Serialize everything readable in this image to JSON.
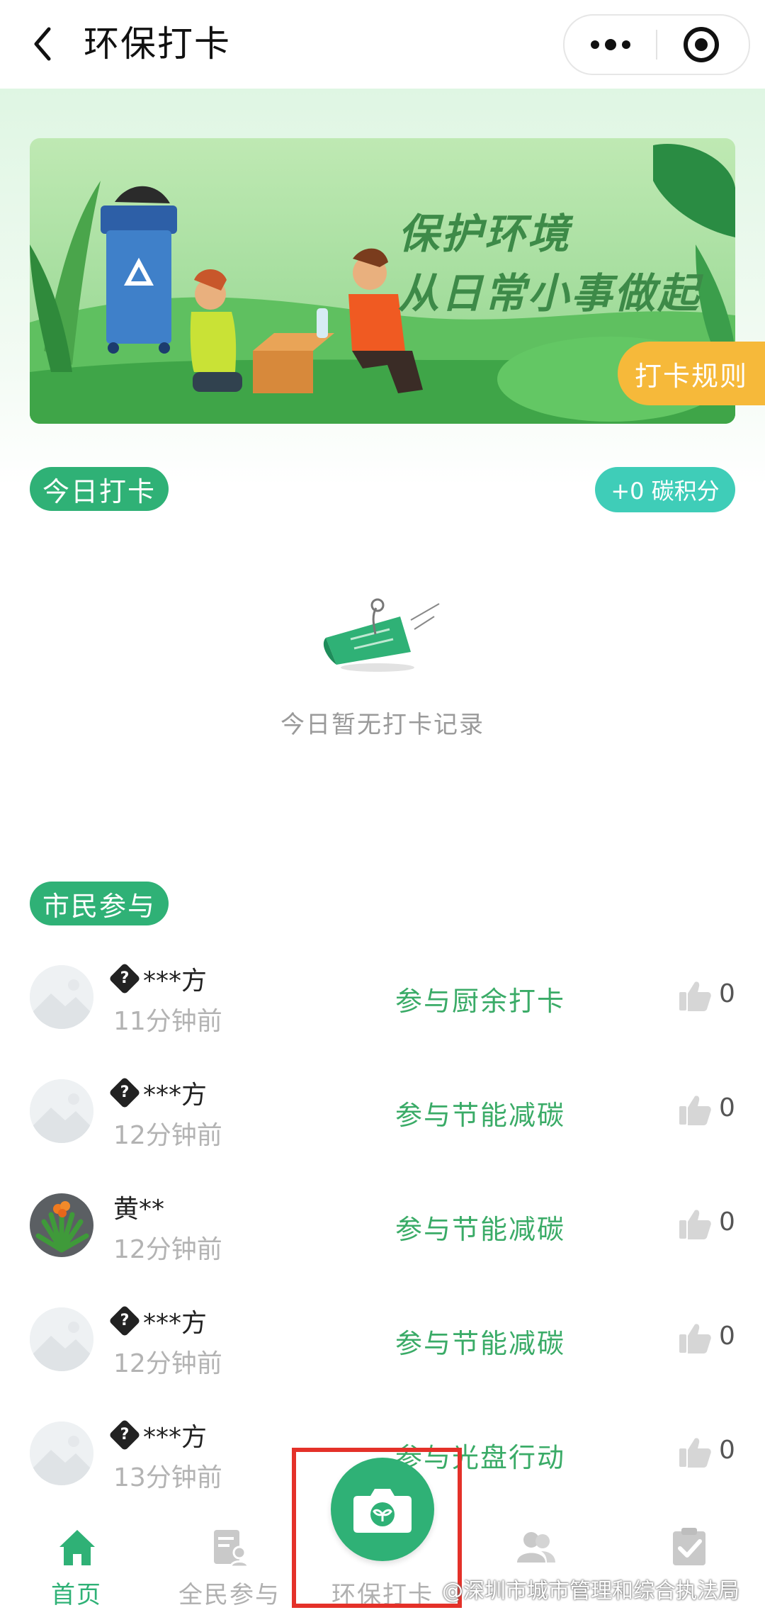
{
  "header": {
    "title": "环保打卡"
  },
  "banner": {
    "line1": "保护环境",
    "line2": "从日常小事做起",
    "rules_label": "打卡规则"
  },
  "today": {
    "label": "今日打卡",
    "points": "+0 碳积分",
    "empty_text": "今日暂无打卡记录"
  },
  "citizen": {
    "label": "市民参与",
    "rows": [
      {
        "name": "***方",
        "time": "11分钟前",
        "action": "参与厨余打卡",
        "likes": "0"
      },
      {
        "name": "***方",
        "time": "12分钟前",
        "action": "参与节能减碳",
        "likes": "0"
      },
      {
        "name": "黄**",
        "time": "12分钟前",
        "action": "参与节能减碳",
        "likes": "0"
      },
      {
        "name": "***方",
        "time": "12分钟前",
        "action": "参与节能减碳",
        "likes": "0"
      },
      {
        "name": "***方",
        "time": "13分钟前",
        "action": "参与光盘行动",
        "likes": "0"
      }
    ]
  },
  "tabs": [
    {
      "label": "首页",
      "icon": "home-icon",
      "active": true
    },
    {
      "label": "全民参与",
      "icon": "participation-icon"
    },
    {
      "label": "环保打卡",
      "icon": "camera-icon"
    },
    {
      "label": "",
      "icon": "group-icon"
    },
    {
      "label": "",
      "icon": "checklist-icon"
    }
  ],
  "watermark": "@深圳市城市管理和综合执法局",
  "colors": {
    "primary": "#2fb176",
    "accent": "#f6b93a",
    "teal": "#3fcdb8",
    "highlight": "#e43129"
  }
}
